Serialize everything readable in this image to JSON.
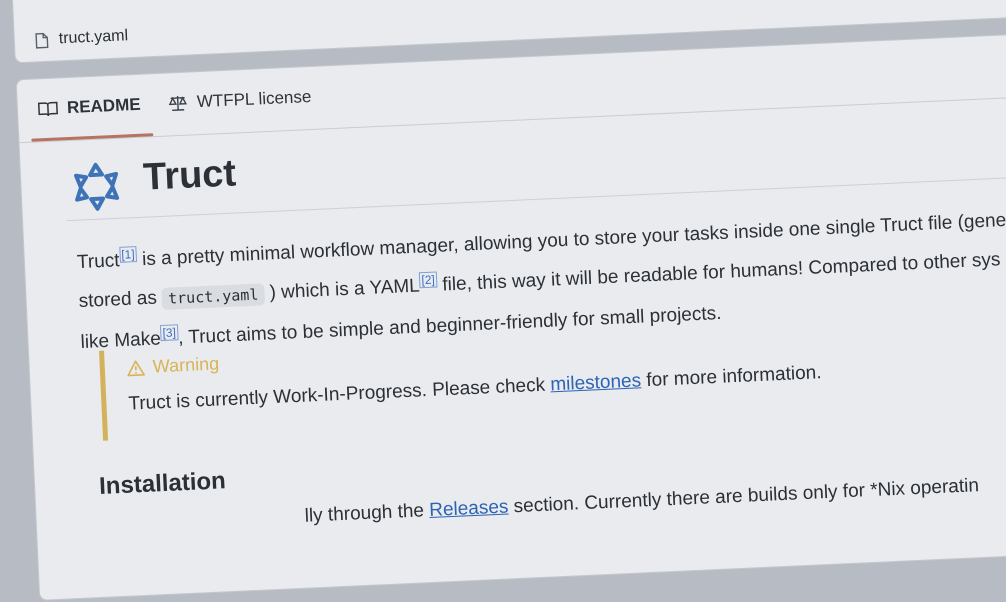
{
  "file": {
    "name": "truct.yaml",
    "icon": "file-icon"
  },
  "tabs": [
    {
      "label": "README",
      "icon": "book-icon",
      "active": true
    },
    {
      "label": "WTFPL license",
      "icon": "scale-icon",
      "active": false
    }
  ],
  "readme": {
    "title": "Truct",
    "paragraph": {
      "word1": "Truct",
      "ref1": "[1]",
      "text1": " is a pretty minimal workflow manager, allowing you to store your tasks inside one single Truct file (gener",
      "text2": "stored as ",
      "code": "truct.yaml",
      "text3": " ) which is a YAML",
      "ref2": "[2]",
      "text4": " file, this way it will be readable for humans! Compared to other sys",
      "text5": "like Make",
      "ref3": "[3]",
      "text6": ", Truct aims to be simple and beginner-friendly for small projects."
    },
    "warning": {
      "label": "Warning",
      "icon": "warning-icon",
      "text_before": "Truct is currently Work-In-Progress. Please check ",
      "link": "milestones",
      "text_after": " for more information."
    },
    "installation": {
      "heading": "Installation",
      "text_before": "lly through the ",
      "link": "Releases",
      "text_after": " section. Currently there are builds only for *Nix operatin"
    }
  },
  "colors": {
    "accent_tab": "#b7735f",
    "warning": "#d4b15b",
    "link": "#2c63b5"
  }
}
